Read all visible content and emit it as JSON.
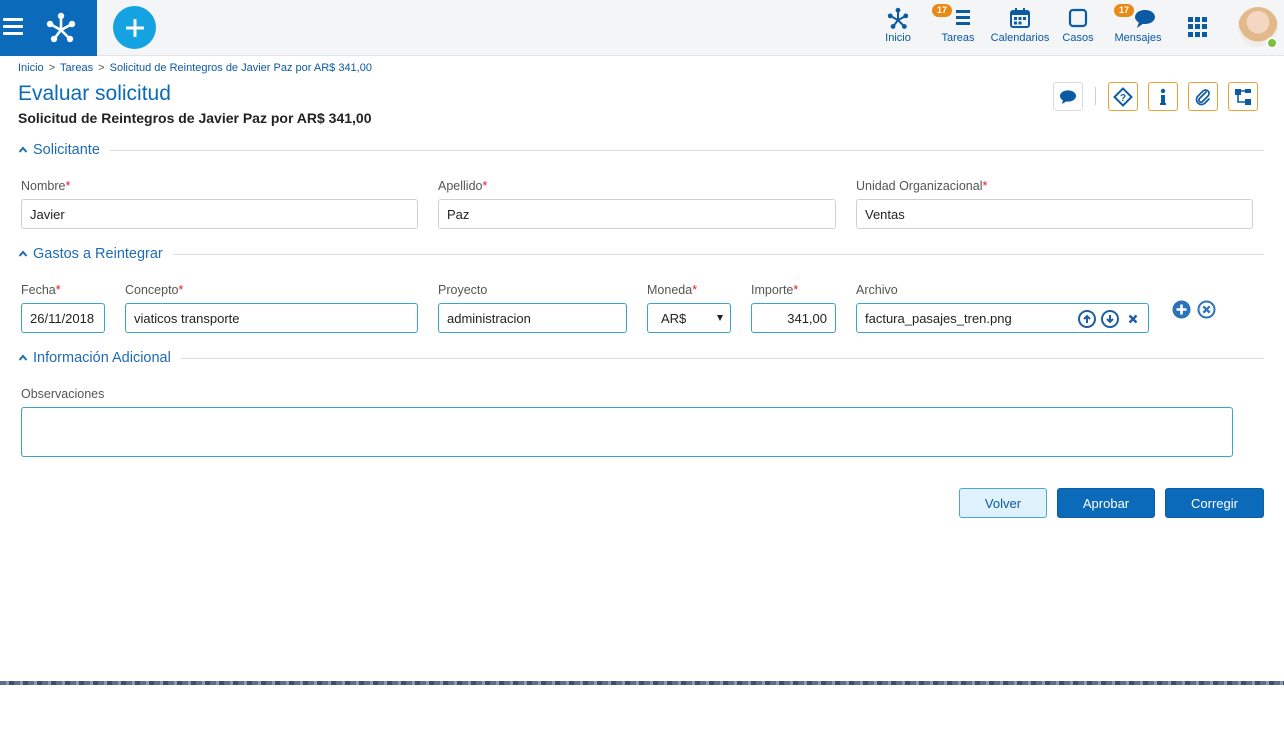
{
  "header": {
    "nav": [
      {
        "label": "Inicio",
        "icon": "process-home-icon",
        "badge": null
      },
      {
        "label": "Tareas",
        "icon": "tasks-icon",
        "badge": "17"
      },
      {
        "label": "Calendarios",
        "icon": "calendar-icon",
        "badge": null
      },
      {
        "label": "Casos",
        "icon": "cases-icon",
        "badge": null
      },
      {
        "label": "Mensajes",
        "icon": "messages-icon",
        "badge": "17"
      }
    ],
    "apps_icon": "apps-grid-icon",
    "colors": {
      "brand": "#0b6aba",
      "accent": "#14a3e0",
      "badge": "#e98a16",
      "online": "#7ac142"
    }
  },
  "breadcrumb": {
    "items": [
      "Inicio",
      "Tareas",
      "Solicitud de Reintegros de Javier Paz por AR$ 341,00"
    ],
    "separator": ">"
  },
  "page": {
    "title": "Evaluar solicitud",
    "subtitle": "Solicitud de Reintegros de Javier Paz por AR$ 341,00"
  },
  "toolbar": [
    "comment-icon",
    "help-icon",
    "info-icon",
    "attachment-icon",
    "workflow-icon"
  ],
  "sections": {
    "solicitante": {
      "title": "Solicitante",
      "fields": {
        "nombre": {
          "label": "Nombre",
          "required": "*",
          "value": "Javier"
        },
        "apellido": {
          "label": "Apellido",
          "required": "*",
          "value": "Paz"
        },
        "unidad": {
          "label": "Unidad Organizacional",
          "required": "*",
          "value": "Ventas"
        }
      }
    },
    "gastos": {
      "title": "Gastos a Reintegrar",
      "fields": {
        "fecha": {
          "label": "Fecha",
          "required": "*",
          "value": "26/11/2018"
        },
        "concepto": {
          "label": "Concepto",
          "required": "*",
          "value": "viaticos transporte"
        },
        "proyecto": {
          "label": "Proyecto",
          "value": "administracion"
        },
        "moneda": {
          "label": "Moneda",
          "required": "*",
          "value": "AR$"
        },
        "importe": {
          "label": "Importe",
          "required": "*",
          "value": "341,00"
        },
        "archivo": {
          "label": "Archivo",
          "value": "factura_pasajes_tren.png"
        }
      }
    },
    "adicional": {
      "title": "Información Adicional",
      "fields": {
        "observaciones": {
          "label": "Observaciones",
          "value": ""
        }
      }
    }
  },
  "actions": {
    "volver": "Volver",
    "aprobar": "Aprobar",
    "corregir": "Corregir"
  }
}
